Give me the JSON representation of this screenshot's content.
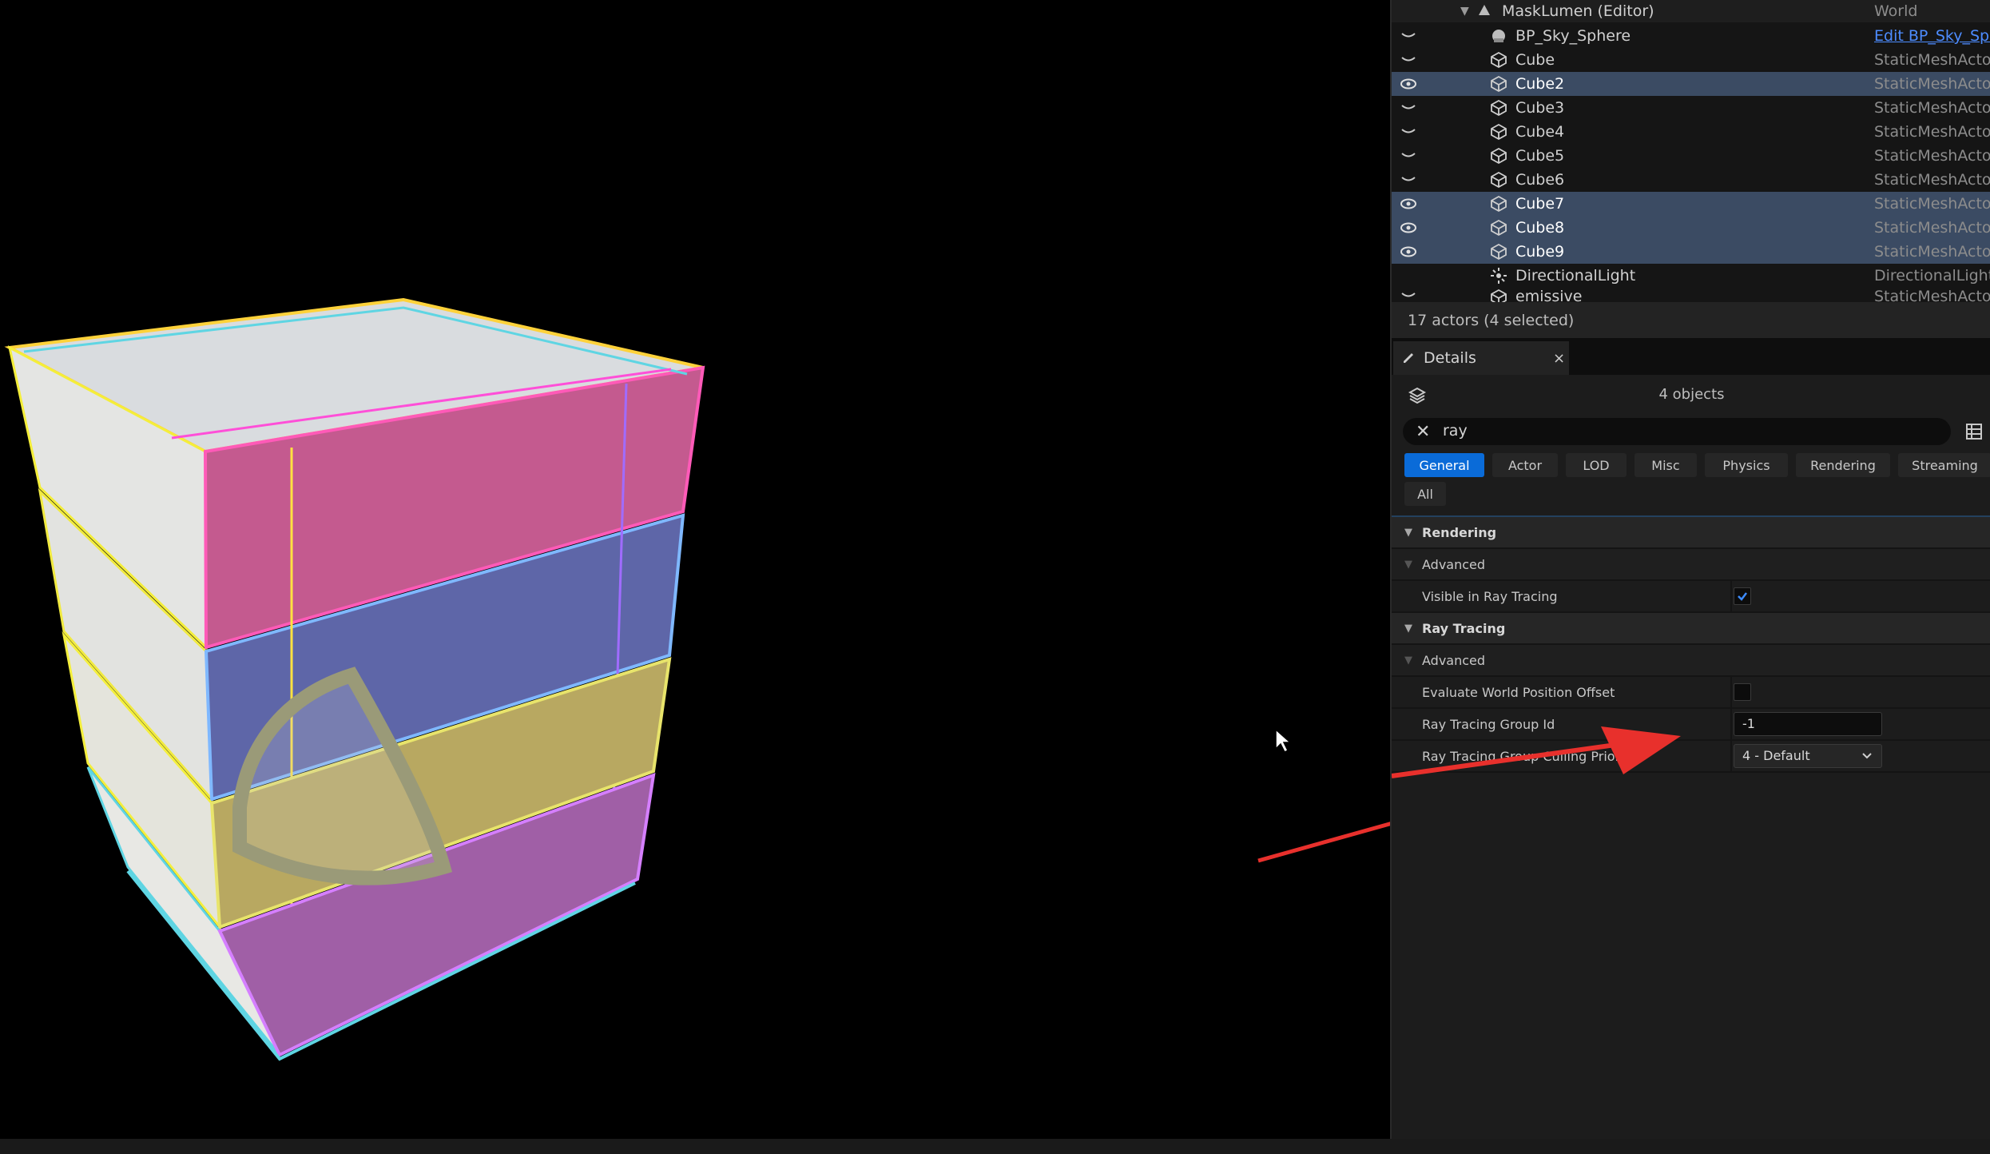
{
  "outliner": {
    "root": {
      "name": "MaskLumen (Editor)",
      "type": "World"
    },
    "rows": [
      {
        "name": "BP_Sky_Sphere",
        "type": "Edit BP_Sky_Sph",
        "type_is_link": true,
        "visible": false,
        "selected": false
      },
      {
        "name": "Cube",
        "type": "StaticMeshActor",
        "visible": false,
        "selected": false
      },
      {
        "name": "Cube2",
        "type": "StaticMeshActor",
        "visible": true,
        "selected": true
      },
      {
        "name": "Cube3",
        "type": "StaticMeshActor",
        "visible": false,
        "selected": false
      },
      {
        "name": "Cube4",
        "type": "StaticMeshActor",
        "visible": false,
        "selected": false
      },
      {
        "name": "Cube5",
        "type": "StaticMeshActor",
        "visible": false,
        "selected": false
      },
      {
        "name": "Cube6",
        "type": "StaticMeshActor",
        "visible": false,
        "selected": false
      },
      {
        "name": "Cube7",
        "type": "StaticMeshActor",
        "visible": true,
        "selected": true
      },
      {
        "name": "Cube8",
        "type": "StaticMeshActor",
        "visible": true,
        "selected": true
      },
      {
        "name": "Cube9",
        "type": "StaticMeshActor",
        "visible": true,
        "selected": true
      },
      {
        "name": "DirectionalLight",
        "type": "DirectionalLight",
        "visible": false,
        "selected": false
      },
      {
        "name": "emissive",
        "type": "StaticMeshActor",
        "visible": false,
        "selected": false
      }
    ],
    "footer": "17 actors (4 selected)"
  },
  "details": {
    "tab_label": "Details",
    "close_glyph": "×",
    "objects_label": "4 objects",
    "search_value": "ray",
    "filter_tabs": [
      "General",
      "Actor",
      "LOD",
      "Misc",
      "Physics",
      "Rendering",
      "Streaming",
      "All"
    ],
    "active_filter": "General",
    "sections": {
      "rendering_title": "Rendering",
      "rendering_advanced": "Advanced",
      "visible_in_ray_tracing_label": "Visible in Ray Tracing",
      "visible_in_ray_tracing": true,
      "ray_tracing_title": "Ray Tracing",
      "ray_tracing_advanced": "Advanced",
      "evaluate_wpo_label": "Evaluate World Position Offset",
      "evaluate_wpo": false,
      "group_id_label": "Ray Tracing Group Id",
      "group_id_value": "-1",
      "culling_priority_label": "Ray Tracing Group Culling Priority",
      "culling_priority_value": "4 - Default"
    }
  },
  "colors": {
    "selected_row": "#3b4b63",
    "active_tab": "#0a6bd8",
    "link": "#4d8cff",
    "annotation_arrow": "#e8302c"
  },
  "icons": [
    "eye-icon",
    "eye-closed-icon",
    "world-icon",
    "static-mesh-icon",
    "sky-sphere-icon",
    "directional-light-icon",
    "pencil-icon",
    "cube-stack-icon",
    "close-icon",
    "grid-view-icon",
    "checkmark-icon",
    "chevron-down-icon",
    "mouse-cursor-icon"
  ]
}
